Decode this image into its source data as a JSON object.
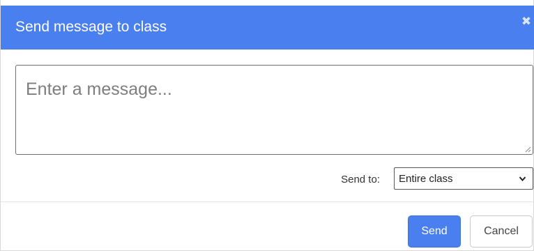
{
  "dialog": {
    "title": "Send message to class",
    "close_glyph": "✖"
  },
  "message": {
    "placeholder": "Enter a message...",
    "value": ""
  },
  "send_to": {
    "label": "Send to:",
    "selected": "Entire class"
  },
  "buttons": {
    "send_label": "Send",
    "cancel_label": "Cancel"
  },
  "colors": {
    "accent": "#4a7ff0",
    "header_text": "#ffffff"
  },
  "icons": {
    "close": "close-icon",
    "dropdown": "chevron-down-icon",
    "resize": "resize-grip-icon"
  }
}
